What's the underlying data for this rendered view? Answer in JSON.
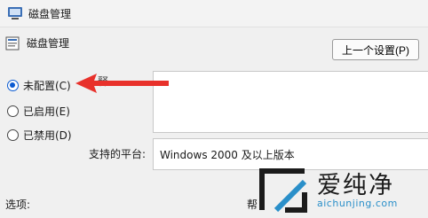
{
  "window": {
    "title": "磁盘管理"
  },
  "header": {
    "setting_title": "磁盘管理",
    "prev_setting_label": "上一个设置(P)"
  },
  "radios": [
    {
      "label": "未配置(C)",
      "checked": true
    },
    {
      "label": "已启用(E)",
      "checked": false
    },
    {
      "label": "已禁用(D)",
      "checked": false
    }
  ],
  "comment": {
    "label_partial": "释"
  },
  "platform": {
    "label": "支持的平台:",
    "value": "Windows 2000 及以上版本"
  },
  "footer": {
    "options_label": "选项:",
    "help_label_partial": "帮"
  },
  "watermark": {
    "text": "爱纯净",
    "url": "aichunjing.com"
  },
  "colors": {
    "accent": "#0a5ad1",
    "arrow": "#e8312b",
    "watermark_blue": "#2a8fc9"
  }
}
